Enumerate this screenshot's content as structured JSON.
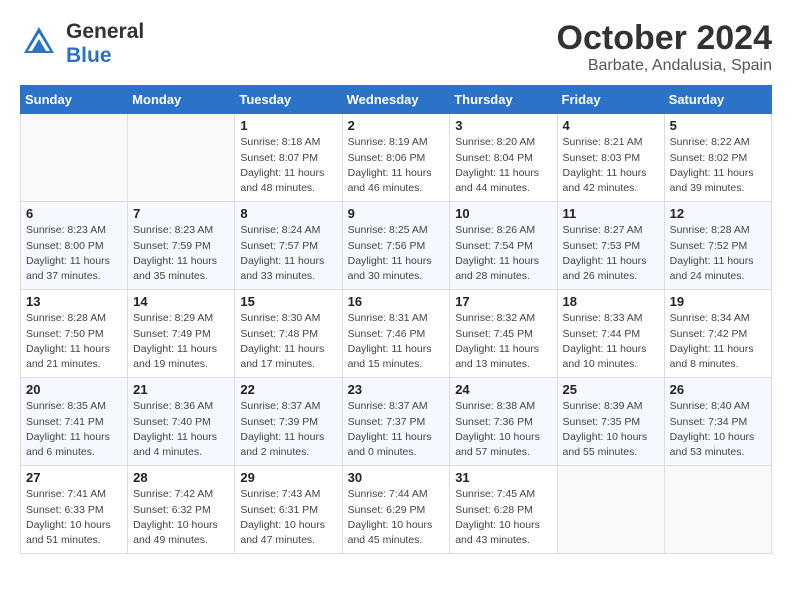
{
  "header": {
    "logo_general": "General",
    "logo_blue": "Blue",
    "month_title": "October 2024",
    "location": "Barbate, Andalusia, Spain"
  },
  "weekdays": [
    "Sunday",
    "Monday",
    "Tuesday",
    "Wednesday",
    "Thursday",
    "Friday",
    "Saturday"
  ],
  "weeks": [
    [
      {
        "day": "",
        "info": ""
      },
      {
        "day": "",
        "info": ""
      },
      {
        "day": "1",
        "info": "Sunrise: 8:18 AM\nSunset: 8:07 PM\nDaylight: 11 hours and 48 minutes."
      },
      {
        "day": "2",
        "info": "Sunrise: 8:19 AM\nSunset: 8:06 PM\nDaylight: 11 hours and 46 minutes."
      },
      {
        "day": "3",
        "info": "Sunrise: 8:20 AM\nSunset: 8:04 PM\nDaylight: 11 hours and 44 minutes."
      },
      {
        "day": "4",
        "info": "Sunrise: 8:21 AM\nSunset: 8:03 PM\nDaylight: 11 hours and 42 minutes."
      },
      {
        "day": "5",
        "info": "Sunrise: 8:22 AM\nSunset: 8:02 PM\nDaylight: 11 hours and 39 minutes."
      }
    ],
    [
      {
        "day": "6",
        "info": "Sunrise: 8:23 AM\nSunset: 8:00 PM\nDaylight: 11 hours and 37 minutes."
      },
      {
        "day": "7",
        "info": "Sunrise: 8:23 AM\nSunset: 7:59 PM\nDaylight: 11 hours and 35 minutes."
      },
      {
        "day": "8",
        "info": "Sunrise: 8:24 AM\nSunset: 7:57 PM\nDaylight: 11 hours and 33 minutes."
      },
      {
        "day": "9",
        "info": "Sunrise: 8:25 AM\nSunset: 7:56 PM\nDaylight: 11 hours and 30 minutes."
      },
      {
        "day": "10",
        "info": "Sunrise: 8:26 AM\nSunset: 7:54 PM\nDaylight: 11 hours and 28 minutes."
      },
      {
        "day": "11",
        "info": "Sunrise: 8:27 AM\nSunset: 7:53 PM\nDaylight: 11 hours and 26 minutes."
      },
      {
        "day": "12",
        "info": "Sunrise: 8:28 AM\nSunset: 7:52 PM\nDaylight: 11 hours and 24 minutes."
      }
    ],
    [
      {
        "day": "13",
        "info": "Sunrise: 8:28 AM\nSunset: 7:50 PM\nDaylight: 11 hours and 21 minutes."
      },
      {
        "day": "14",
        "info": "Sunrise: 8:29 AM\nSunset: 7:49 PM\nDaylight: 11 hours and 19 minutes."
      },
      {
        "day": "15",
        "info": "Sunrise: 8:30 AM\nSunset: 7:48 PM\nDaylight: 11 hours and 17 minutes."
      },
      {
        "day": "16",
        "info": "Sunrise: 8:31 AM\nSunset: 7:46 PM\nDaylight: 11 hours and 15 minutes."
      },
      {
        "day": "17",
        "info": "Sunrise: 8:32 AM\nSunset: 7:45 PM\nDaylight: 11 hours and 13 minutes."
      },
      {
        "day": "18",
        "info": "Sunrise: 8:33 AM\nSunset: 7:44 PM\nDaylight: 11 hours and 10 minutes."
      },
      {
        "day": "19",
        "info": "Sunrise: 8:34 AM\nSunset: 7:42 PM\nDaylight: 11 hours and 8 minutes."
      }
    ],
    [
      {
        "day": "20",
        "info": "Sunrise: 8:35 AM\nSunset: 7:41 PM\nDaylight: 11 hours and 6 minutes."
      },
      {
        "day": "21",
        "info": "Sunrise: 8:36 AM\nSunset: 7:40 PM\nDaylight: 11 hours and 4 minutes."
      },
      {
        "day": "22",
        "info": "Sunrise: 8:37 AM\nSunset: 7:39 PM\nDaylight: 11 hours and 2 minutes."
      },
      {
        "day": "23",
        "info": "Sunrise: 8:37 AM\nSunset: 7:37 PM\nDaylight: 11 hours and 0 minutes."
      },
      {
        "day": "24",
        "info": "Sunrise: 8:38 AM\nSunset: 7:36 PM\nDaylight: 10 hours and 57 minutes."
      },
      {
        "day": "25",
        "info": "Sunrise: 8:39 AM\nSunset: 7:35 PM\nDaylight: 10 hours and 55 minutes."
      },
      {
        "day": "26",
        "info": "Sunrise: 8:40 AM\nSunset: 7:34 PM\nDaylight: 10 hours and 53 minutes."
      }
    ],
    [
      {
        "day": "27",
        "info": "Sunrise: 7:41 AM\nSunset: 6:33 PM\nDaylight: 10 hours and 51 minutes."
      },
      {
        "day": "28",
        "info": "Sunrise: 7:42 AM\nSunset: 6:32 PM\nDaylight: 10 hours and 49 minutes."
      },
      {
        "day": "29",
        "info": "Sunrise: 7:43 AM\nSunset: 6:31 PM\nDaylight: 10 hours and 47 minutes."
      },
      {
        "day": "30",
        "info": "Sunrise: 7:44 AM\nSunset: 6:29 PM\nDaylight: 10 hours and 45 minutes."
      },
      {
        "day": "31",
        "info": "Sunrise: 7:45 AM\nSunset: 6:28 PM\nDaylight: 10 hours and 43 minutes."
      },
      {
        "day": "",
        "info": ""
      },
      {
        "day": "",
        "info": ""
      }
    ]
  ]
}
